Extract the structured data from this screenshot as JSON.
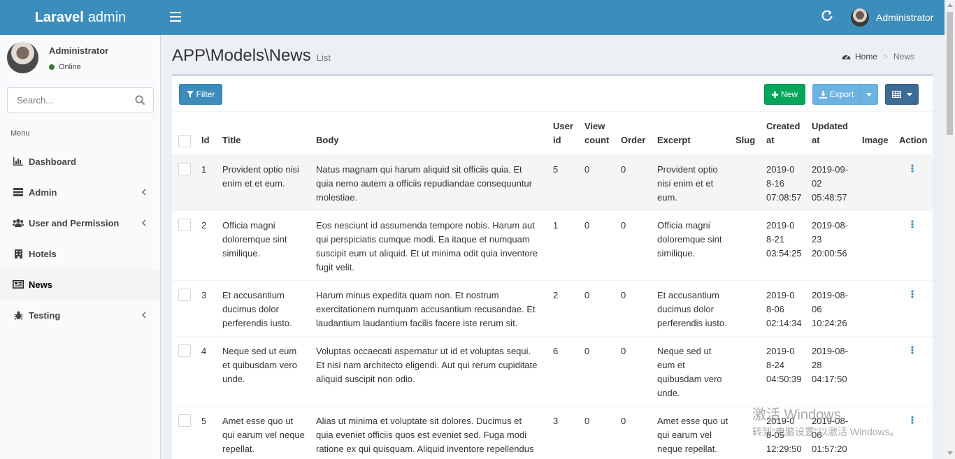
{
  "header": {
    "logo_bold": "Laravel",
    "logo_rest": "admin",
    "user_name": "Administrator"
  },
  "sidebar": {
    "user": {
      "name": "Administrator",
      "status": "Online"
    },
    "search_placeholder": "Search...",
    "menu_header": "Menu",
    "items": [
      {
        "label": "Dashboard",
        "icon": "bar-chart-icon",
        "has_children": false
      },
      {
        "label": "Admin",
        "icon": "tasks-icon",
        "has_children": true
      },
      {
        "label": "User and Permission",
        "icon": "users-icon",
        "has_children": true
      },
      {
        "label": "Hotels",
        "icon": "building-icon",
        "has_children": false
      },
      {
        "label": "News",
        "icon": "newspaper-icon",
        "has_children": false,
        "active": true
      },
      {
        "label": "Testing",
        "icon": "bug-icon",
        "has_children": true
      }
    ]
  },
  "page": {
    "title": "APP\\Models\\News",
    "subtitle": "List",
    "breadcrumb": {
      "home": "Home",
      "current": "News"
    }
  },
  "toolbar": {
    "filter_label": "Filter",
    "new_label": "New",
    "export_label": "Export"
  },
  "table": {
    "headers": {
      "id": "Id",
      "title": "Title",
      "body": "Body",
      "user_id_1": "User",
      "user_id_2": "id",
      "view_count_1": "View",
      "view_count_2": "count",
      "order": "Order",
      "excerpt": "Excerpt",
      "slug": "Slug",
      "created_at_1": "Created",
      "created_at_2": "at",
      "updated_at_1": "Updated",
      "updated_at_2": "at",
      "image": "Image",
      "action": "Action"
    },
    "rows": [
      {
        "id": "1",
        "title": "Provident optio nisi enim et et eum.",
        "body": "Natus magnam qui harum aliquid sit officiis quia. Et quia nemo autem a officiis repudiandae consequuntur molestiae.",
        "user_id": "5",
        "view_count": "0",
        "order": "0",
        "excerpt": "Provident optio nisi enim et et eum.",
        "slug": "",
        "created_date": "2019-08-16",
        "created_time": "07:08:57",
        "updated_date": "2019-09-02",
        "updated_time": "05:48:57",
        "image": ""
      },
      {
        "id": "2",
        "title": "Officia magni doloremque sint similique.",
        "body": "Eos nesciunt id assumenda tempore nobis. Harum aut qui perspiciatis cumque modi. Ea itaque et numquam suscipit eum ut aliquid. Et ut minima odit quia inventore fugit velit.",
        "user_id": "1",
        "view_count": "0",
        "order": "0",
        "excerpt": "Officia magni doloremque sint similique.",
        "slug": "",
        "created_date": "2019-08-21",
        "created_time": "03:54:25",
        "updated_date": "2019-08-23",
        "updated_time": "20:00:56",
        "image": ""
      },
      {
        "id": "3",
        "title": "Et accusantium ducimus dolor perferendis iusto.",
        "body": "Harum minus expedita quam non. Et nostrum exercitationem numquam accusantium recusandae. Et laudantium laudantium facilis facere iste rerum sit.",
        "user_id": "2",
        "view_count": "0",
        "order": "0",
        "excerpt": "Et accusantium ducimus dolor perferendis iusto.",
        "slug": "",
        "created_date": "2019-08-06",
        "created_time": "02:14:34",
        "updated_date": "2019-08-06",
        "updated_time": "10:24:26",
        "image": ""
      },
      {
        "id": "4",
        "title": "Neque sed ut eum et quibusdam vero unde.",
        "body": "Voluptas occaecati aspernatur ut id et voluptas sequi. Et nisi nam architecto eligendi. Aut qui rerum cupiditate aliquid suscipit non odio.",
        "user_id": "6",
        "view_count": "0",
        "order": "0",
        "excerpt": "Neque sed ut eum et quibusdam vero unde.",
        "slug": "",
        "created_date": "2019-08-24",
        "created_time": "04:50:39",
        "updated_date": "2019-08-28",
        "updated_time": "04:17:50",
        "image": ""
      },
      {
        "id": "5",
        "title": "Amet esse quo ut qui earum vel neque repellat.",
        "body": "Alias ut minima et voluptate sit dolores. Ducimus et quia eveniet officiis quos est eveniet sed. Fuga modi ratione ex qui quisquam. Aliquid inventore repellendus",
        "user_id": "3",
        "view_count": "0",
        "order": "0",
        "excerpt": "Amet esse quo ut qui earum vel neque repellat.",
        "slug": "",
        "created_date": "2019-08-05",
        "created_time": "12:29:50",
        "updated_date": "2019-08-06",
        "updated_time": "01:57:20",
        "image": ""
      }
    ]
  },
  "watermark": {
    "line1": "激活 Windows",
    "line2": "转到\"电脑设置\"以激活 Windows。"
  }
}
